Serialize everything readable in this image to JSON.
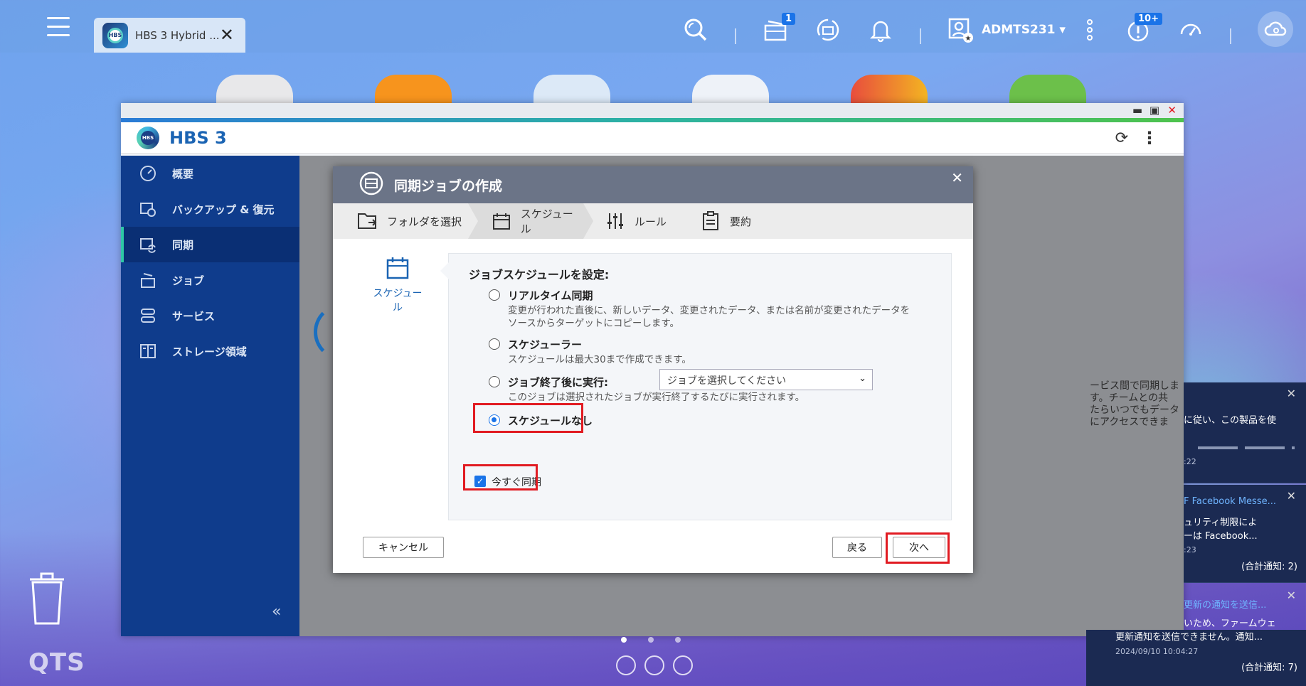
{
  "taskbar": {
    "tab_title": "HBS 3 Hybrid ...",
    "tab_logo_text": "HBS",
    "username": "ADMTS231",
    "badge_tasks": "1",
    "badge_notifications": "10+"
  },
  "window": {
    "app_title": "HBS 3",
    "logo_text": "HBS",
    "sidebar": [
      {
        "label": "概要"
      },
      {
        "label": "バックアップ & 復元"
      },
      {
        "label": "同期"
      },
      {
        "label": "ジョブ"
      },
      {
        "label": "サービス"
      },
      {
        "label": "ストレージ領域"
      }
    ],
    "background_text_line1": "ービス間で同期します。チームとの共",
    "background_text_line2": "たらいつでもデータにアクセスできま"
  },
  "modal": {
    "title": "同期ジョブの作成",
    "steps": [
      {
        "label": "フォルダを選択"
      },
      {
        "label": "スケジュール"
      },
      {
        "label": "ルール"
      },
      {
        "label": "要約"
      }
    ],
    "left_label": "スケジュール",
    "heading": "ジョブスケジュールを設定:",
    "options": {
      "realtime": {
        "label": "リアルタイム同期",
        "desc1": "変更が行われた直後に、新しいデータ、変更されたデータ、または名前が変更されたデータを",
        "desc2": "ソースからターゲットにコピーします。"
      },
      "scheduler": {
        "label": "スケジューラー",
        "desc": "スケジュールは最大30まで作成できます。"
      },
      "after_job": {
        "label": "ジョブ終了後に実行:",
        "select_value": "ジョブを選択してください",
        "desc": "このジョブは選択されたジョブが実行終了するたびに実行されます。"
      },
      "none": {
        "label": "スケジュールなし",
        "selected": true
      }
    },
    "sync_now": {
      "label": "今すぐ同期",
      "checked": true
    },
    "buttons": {
      "cancel": "キャンセル",
      "back": "戻る",
      "next": "次へ"
    },
    "highlight_color": "#e11b22"
  },
  "notifications": [
    {
      "text": "に従い、この製品を使",
      "time": ":22"
    },
    {
      "title": "F Facebook Messe...",
      "text1": "ュリティ制限によ",
      "text2": "ーは Facebook...",
      "time": ":23",
      "total": "(合計通知: 2)"
    },
    {
      "title": "更新の通知を送信...",
      "text1": "いため、ファームウェ",
      "text2": "更新通知を送信できません。通知...",
      "time": "2024/09/10 10:04:27",
      "total": "(合計通知: 7)"
    }
  ],
  "desktop": {
    "brand": "QTS"
  }
}
